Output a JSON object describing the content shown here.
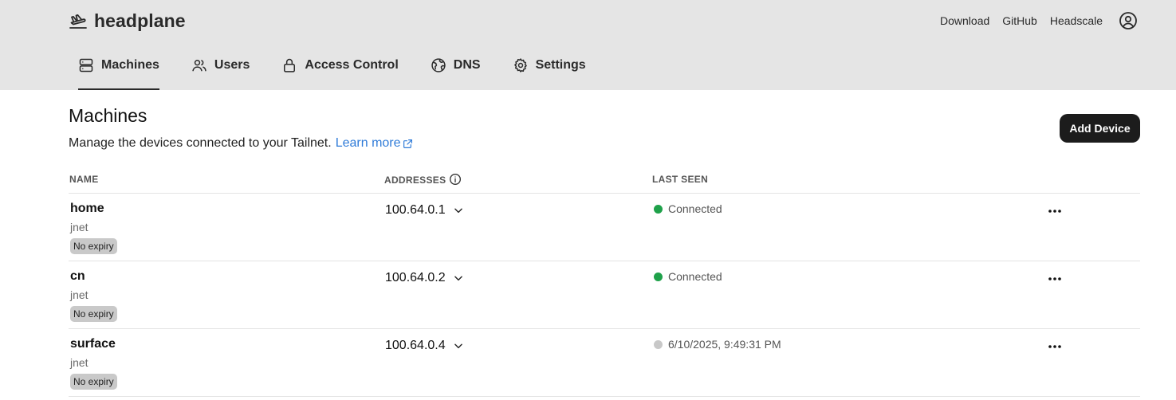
{
  "app": {
    "name": "headplane",
    "logo_icon": "paper-plane-icon"
  },
  "header_links": [
    "Download",
    "GitHub",
    "Headscale"
  ],
  "nav": {
    "tabs": [
      {
        "label": "Machines",
        "icon": "server-icon",
        "active": true
      },
      {
        "label": "Users",
        "icon": "users-icon"
      },
      {
        "label": "Access Control",
        "icon": "lock-icon"
      },
      {
        "label": "DNS",
        "icon": "globe-icon"
      },
      {
        "label": "Settings",
        "icon": "gear-icon"
      }
    ]
  },
  "page": {
    "title": "Machines",
    "subtitle": "Manage the devices connected to your Tailnet.",
    "learn_more": "Learn more",
    "add_button": "Add Device"
  },
  "table": {
    "headers": {
      "name": "NAME",
      "addresses": "ADDRESSES",
      "last_seen": "LAST SEEN"
    },
    "rows": [
      {
        "name": "home",
        "user": "jnet",
        "badge": "No expiry",
        "address": "100.64.0.1",
        "last_seen": "Connected",
        "online": true
      },
      {
        "name": "cn",
        "user": "jnet",
        "badge": "No expiry",
        "address": "100.64.0.2",
        "last_seen": "Connected",
        "online": true
      },
      {
        "name": "surface",
        "user": "jnet",
        "badge": "No expiry",
        "address": "100.64.0.4",
        "last_seen": "6/10/2025, 9:49:31 PM",
        "online": false
      }
    ]
  },
  "colors": {
    "online": "#1fa14a",
    "offline": "#c8c8c8",
    "link": "#2f7bd8",
    "topbar": "#e5e5e5"
  }
}
